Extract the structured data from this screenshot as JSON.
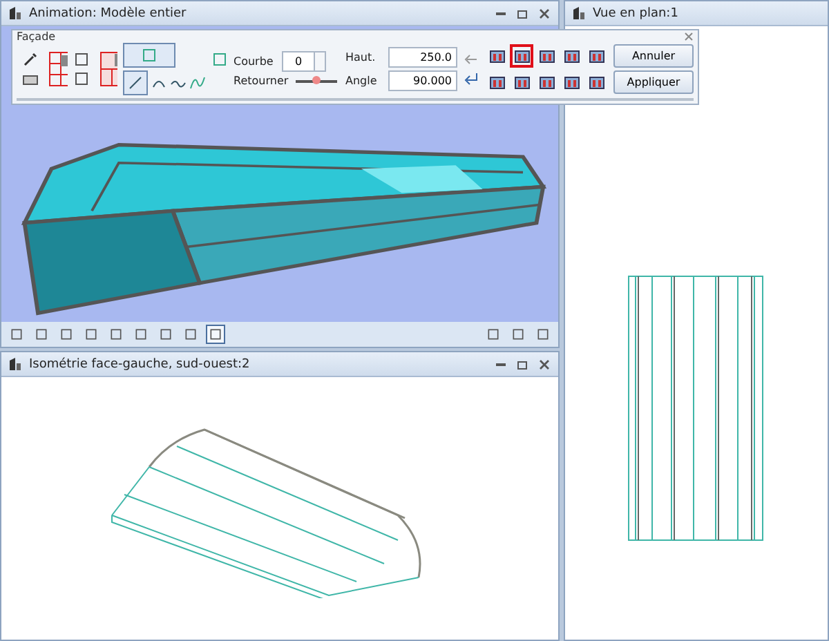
{
  "windows": [
    {
      "title": "Animation: Modèle entier"
    },
    {
      "title": "Isométrie face-gauche, sud-ouest:2"
    },
    {
      "title": "Vue en plan:1"
    }
  ],
  "dialog": {
    "title": "Façade",
    "mode_buttons": [
      {
        "selected": true
      },
      {
        "selected": true
      }
    ],
    "curve": {
      "label": "Courbe",
      "value": "0"
    },
    "height": {
      "label": "Haut.",
      "value": "250.0"
    },
    "flip": {
      "label": "Retourner"
    },
    "angle": {
      "label": "Angle",
      "value": "90.000"
    },
    "side_buttons": [
      {
        "selected": false
      },
      {
        "selected": true
      },
      {
        "selected": false
      },
      {
        "selected": false
      },
      {
        "selected": false
      },
      {
        "selected": false
      },
      {
        "selected": false
      },
      {
        "selected": false
      },
      {
        "selected": false
      },
      {
        "selected": false
      }
    ],
    "buttons": [
      "Annuler",
      "Appliquer"
    ]
  },
  "view_toolbar": [
    {
      "selected": false
    },
    {
      "selected": false
    },
    {
      "selected": false
    },
    {
      "selected": false
    },
    {
      "selected": false
    },
    {
      "selected": false
    },
    {
      "selected": false
    },
    {
      "selected": false
    },
    {
      "selected": true
    },
    {
      "selected": false
    },
    {
      "selected": false
    },
    {
      "selected": false
    }
  ]
}
